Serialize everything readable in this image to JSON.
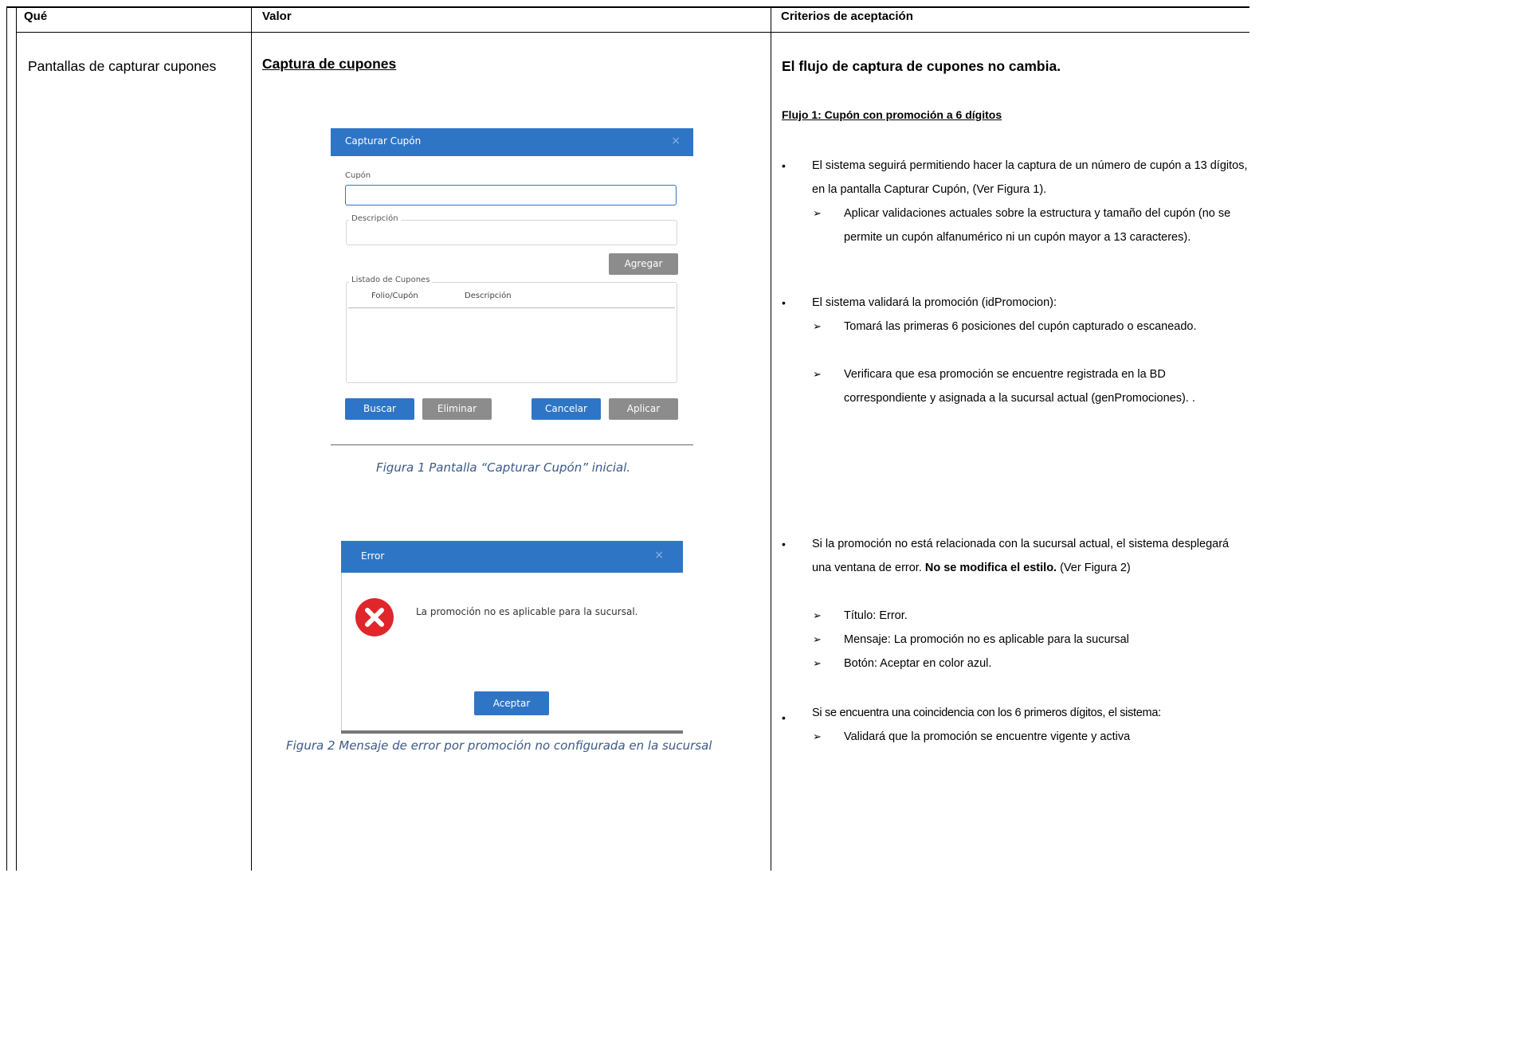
{
  "headers": {
    "col1": "Qué",
    "col2": "Valor",
    "col3": "Criterios de aceptación"
  },
  "col1": {
    "text": "Pantallas de capturar cupones"
  },
  "col2": {
    "title": "Captura de cupones",
    "figure1": {
      "dialog_title": "Capturar Cupón",
      "close_glyph": "×",
      "cupon_label": "Cupón",
      "descripcion_legend": "Descripción",
      "agregar_button": "Agregar",
      "listado_legend": "Listado de Cupones",
      "col_folio": "Folio/Cupón",
      "col_descripcion": "Descripción",
      "buscar_button": "Buscar",
      "eliminar_button": "Eliminar",
      "cancelar_button": "Cancelar",
      "aplicar_button": "Aplicar",
      "caption": "Figura 1 Pantalla “Capturar Cupón” inicial."
    },
    "figure2": {
      "dialog_title": "Error",
      "close_glyph": "×",
      "message": "La promoción no es aplicable para la sucursal.",
      "aceptar_button": "Aceptar",
      "caption": "Figura 2 Mensaje de error por promoción no configurada en la sucursal"
    }
  },
  "col3": {
    "title": "El flujo de captura de cupones no cambia.",
    "subtitle": "Flujo 1: Cupón con promoción a 6 dígitos",
    "bullet_glyph": "•",
    "arrow_glyph": "➢",
    "b1": "El sistema seguirá permitiendo hacer la captura de un número de cupón a 13 dígitos, en la pantalla Capturar Cupón, (Ver Figura 1).",
    "b1_a1": "Aplicar validaciones actuales sobre la estructura y tamaño del cupón (no se permite un cupón alfanumérico ni un cupón mayor a 13 caracteres).",
    "b2": "El sistema validará  la promoción (idPromocion):",
    "b2_a1": "Tomará las primeras 6 posiciones del cupón capturado o escaneado.",
    "b2_a2": "Verificara que esa promoción se encuentre registrada en la BD correspondiente y asignada a la sucursal actual (genPromociones). .",
    "b3_pre": "Si la promoción no está relacionada con la sucursal actual, el sistema desplegará una ventana de error. ",
    "b3_bold": "No se modifica el estilo.",
    "b3_post": " (Ver Figura 2)",
    "b3_a1": "Título: Error.",
    "b3_a2": "Mensaje: La promoción no es aplicable para la sucursal",
    "b3_a3": "Botón: Aceptar en color azul.",
    "b4": "Si se encuentra una coincidencia con los 6 primeros dígitos, el sistema:",
    "b4_a1": "Validará que la promoción se encuentre vigente y activa"
  },
  "colors": {
    "dialog_blue": "#2f75c6",
    "caption_blue": "#3d5a86",
    "error_red": "#e0262b",
    "button_gray": "#8c8c8c"
  }
}
